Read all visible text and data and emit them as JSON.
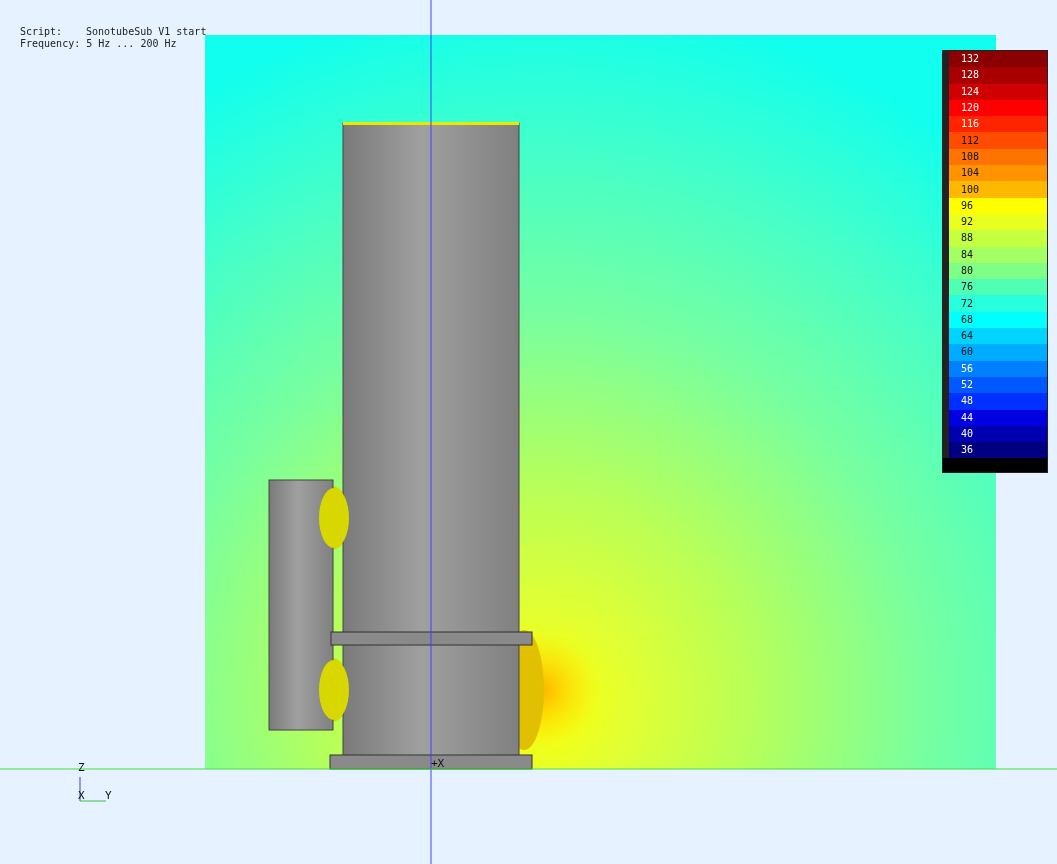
{
  "header": {
    "script_label": "Script:",
    "script_value": "SonotubeSub V1 start",
    "frequency_label": "Frequency:",
    "frequency_value": "5 Hz ... 200 Hz"
  },
  "legend": [
    {
      "label": "132",
      "color": "#8b0000"
    },
    {
      "label": "128",
      "color": "#a80000"
    },
    {
      "label": "124",
      "color": "#d00000"
    },
    {
      "label": "120",
      "color": "#ff0000"
    },
    {
      "label": "116",
      "color": "#ff2400"
    },
    {
      "label": "112",
      "color": "#ff4c00"
    },
    {
      "label": "108",
      "color": "#ff7400"
    },
    {
      "label": "104",
      "color": "#ff9400"
    },
    {
      "label": "100",
      "color": "#ffb800"
    },
    {
      "label": "96",
      "color": "#ffff00"
    },
    {
      "label": "92",
      "color": "#e8ff20"
    },
    {
      "label": "88",
      "color": "#c4ff40"
    },
    {
      "label": "84",
      "color": "#a4ff64"
    },
    {
      "label": "80",
      "color": "#80ff88"
    },
    {
      "label": "76",
      "color": "#50ffb4"
    },
    {
      "label": "72",
      "color": "#28ffdc"
    },
    {
      "label": "68",
      "color": "#00ffff"
    },
    {
      "label": "64",
      "color": "#00d4ff"
    },
    {
      "label": "60",
      "color": "#00acff"
    },
    {
      "label": "56",
      "color": "#0080ff"
    },
    {
      "label": "52",
      "color": "#0058ff"
    },
    {
      "label": "48",
      "color": "#0030ff"
    },
    {
      "label": "44",
      "color": "#0000e0"
    },
    {
      "label": "40",
      "color": "#0000b0"
    },
    {
      "label": "36",
      "color": "#000080"
    }
  ],
  "axes": {
    "z": "Z",
    "x": "X",
    "y": "Y",
    "origin": "+X"
  }
}
